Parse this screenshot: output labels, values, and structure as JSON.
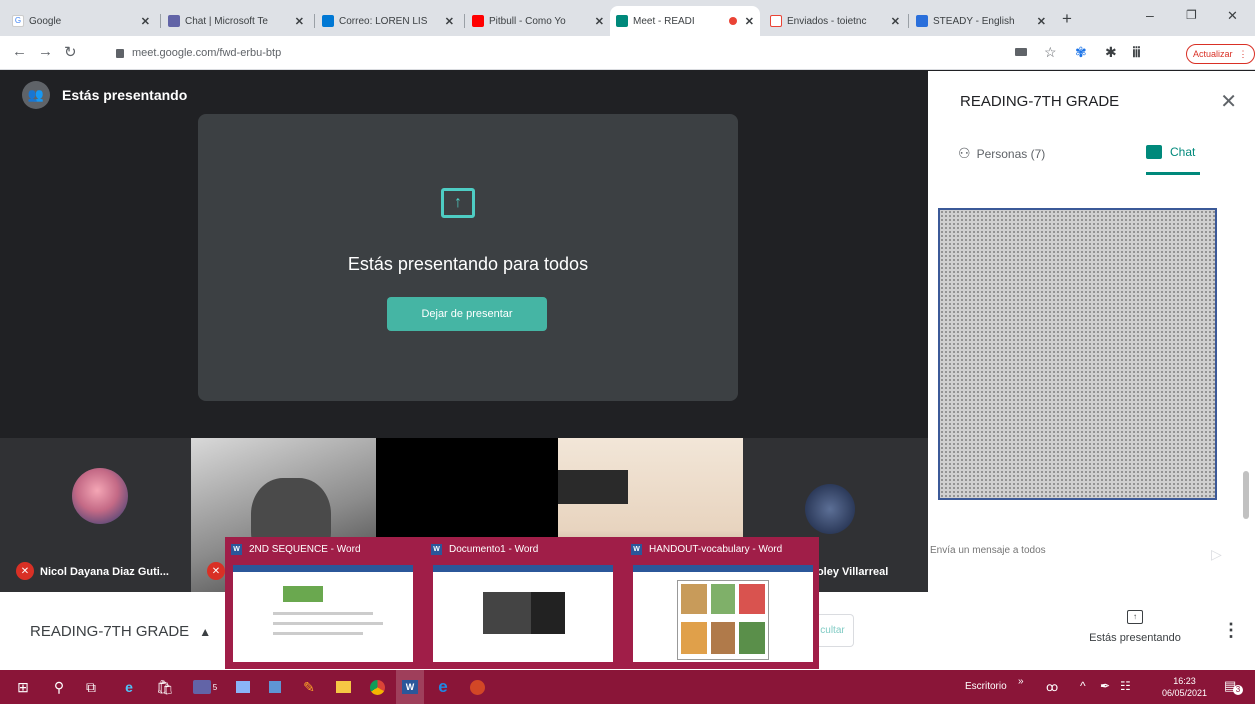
{
  "browser": {
    "tabs": [
      {
        "label": "Google",
        "icon": "google-icon",
        "color": "#4285f4"
      },
      {
        "label": "Chat | Microsoft Te",
        "icon": "teams-icon",
        "color": "#6264a7"
      },
      {
        "label": "Correo: LOREN LIS",
        "icon": "outlook-icon",
        "color": "#0078d4"
      },
      {
        "label": "Pitbull - Como Yo",
        "icon": "youtube-icon",
        "color": "#ff0000"
      },
      {
        "label": "Meet - READI",
        "icon": "meet-icon",
        "color": "#00897b"
      },
      {
        "label": "Enviados - toietnc",
        "icon": "gmail-icon",
        "color": "#ea4335"
      },
      {
        "label": "STEADY - English",
        "icon": "wr-icon",
        "color": "#2a6fdb"
      }
    ],
    "url": "meet.google.com/fwd-erbu-btp",
    "update_label": "Actualizar"
  },
  "meet": {
    "banner": "Estás presentando",
    "present_message": "Estás presentando para todos",
    "stop_label": "Dejar de presentar",
    "participants": [
      {
        "name": "Nicol Dayana Diaz Guti..."
      },
      {
        "name": "Coley Villarreal"
      }
    ]
  },
  "panel": {
    "title": "READING-7TH GRADE",
    "people_tab": "Personas (7)",
    "chat_tab": "Chat",
    "input_placeholder": "Envía un mensaje a todos"
  },
  "meetbar": {
    "meeting_name": "READING-7TH GRADE",
    "present_label": "Estás presentando",
    "hide_label": "cultar"
  },
  "previews": [
    {
      "title": "2ND SEQUENCE - Word"
    },
    {
      "title": "Documento1 - Word"
    },
    {
      "title": "HANDOUT-vocabulary - Word"
    }
  ],
  "taskbar": {
    "desktop_label": "Escritorio",
    "time": "16:23",
    "date": "06/05/2021",
    "badge": "5",
    "notif_count": "3"
  },
  "colors": {
    "accent": "#45b5a4",
    "taskbar": "#8a1538",
    "preview": "#a01e48"
  }
}
